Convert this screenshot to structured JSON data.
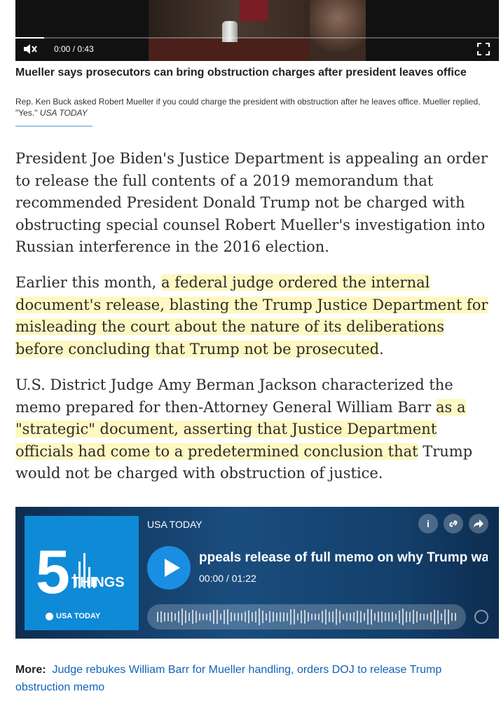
{
  "video": {
    "time_current": "0:00",
    "time_separator": "/",
    "time_total": "0:43",
    "progress_fraction": 0.06
  },
  "caption": {
    "title": "Mueller says prosecutors can bring obstruction charges after president leaves office",
    "description": "Rep. Ken Buck asked Robert Mueller if you could charge the president with obstruction after he leaves office. Mueller replied, \"Yes.\"",
    "source": "USA TODAY"
  },
  "article": {
    "p1": "President Joe Biden's Justice Department is appealing an order to release the full contents of a 2019 memorandum that recommended President Donald Trump not be charged with obstructing special counsel Robert Mueller's investigation into Russian interference in the 2016 election.",
    "p2_a": "Earlier this month, ",
    "p2_hl": "a federal judge ordered the internal document's release, blasting the Trump Justice Department for misleading the court about the nature of its deliberations before concluding that Trump not be prosecuted",
    "p2_b": ".",
    "p3_a": "U.S. District Judge Amy Berman Jackson characterized the memo prepared for then-Attorney General William Barr ",
    "p3_hl": "as a \"strategic\" document, asserting that Justice Department officials had come to a predetermined conclusion that",
    "p3_b": " Trump would not be charged with obstruction of justice."
  },
  "podcast": {
    "publisher": "USA TODAY",
    "art_number": "5",
    "art_word": "THINGS",
    "art_brand": "USA TODAY",
    "episode_title": "ppeals release of full memo on why Trump wa",
    "time": "00:00 / 01:22",
    "info_icon": "info-icon",
    "link_icon": "link-icon",
    "share_icon": "share-arrow-icon"
  },
  "more": {
    "label": "More:",
    "link_text": "Judge rebukes William Barr for Mueller handling, orders DOJ to release Trump obstruction memo"
  }
}
